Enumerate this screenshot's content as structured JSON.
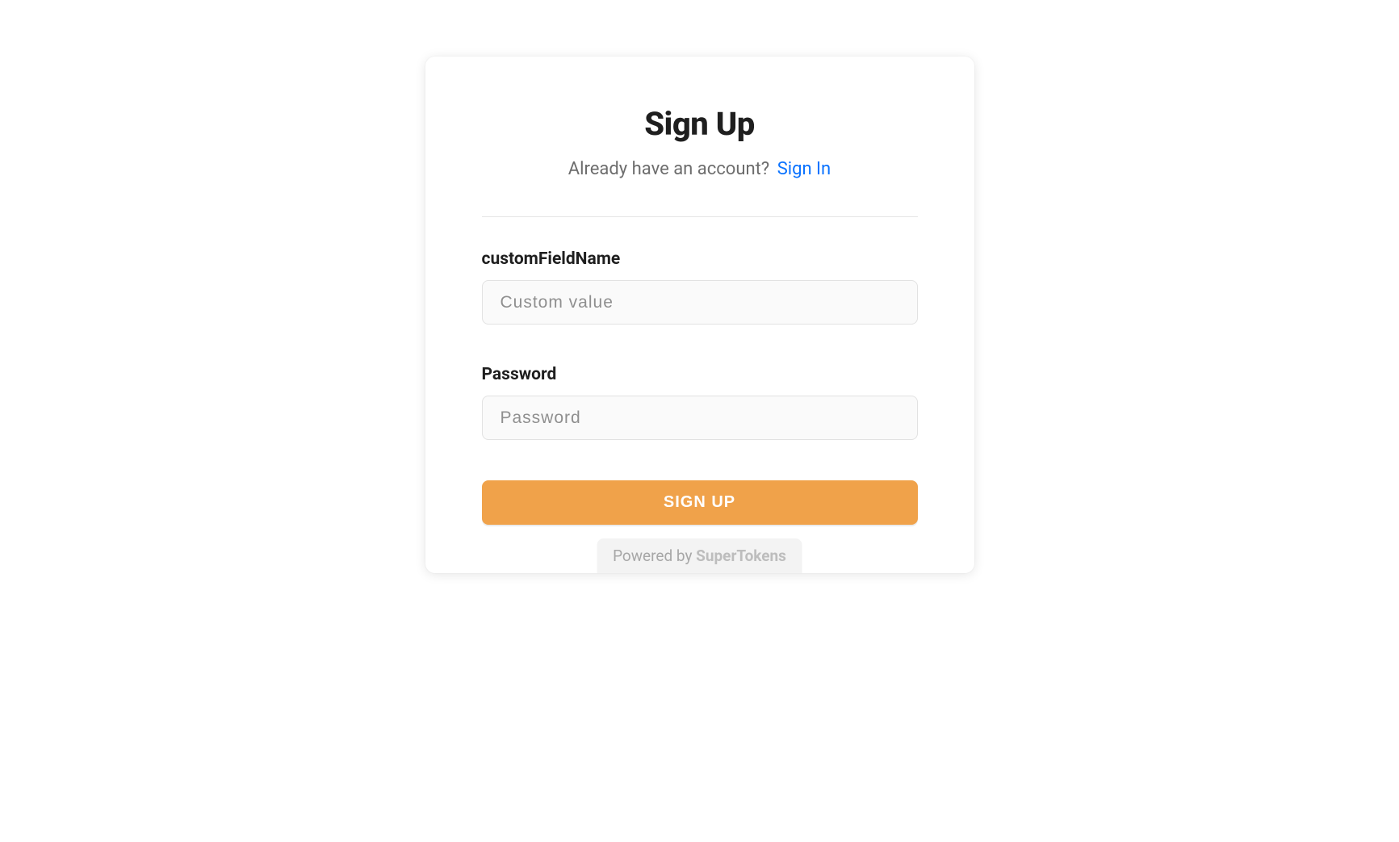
{
  "header": {
    "title": "Sign Up",
    "subtitle_text": "Already have an account?",
    "subtitle_link": "Sign In"
  },
  "fields": {
    "custom": {
      "label": "customFieldName",
      "placeholder": "Custom value",
      "value": ""
    },
    "password": {
      "label": "Password",
      "placeholder": "Password",
      "value": ""
    }
  },
  "submit": {
    "label": "SIGN UP"
  },
  "brand": {
    "prefix": "Powered by ",
    "name": "SuperTokens"
  },
  "colors": {
    "accent": "#f0a24a",
    "link": "#0b73ff"
  }
}
